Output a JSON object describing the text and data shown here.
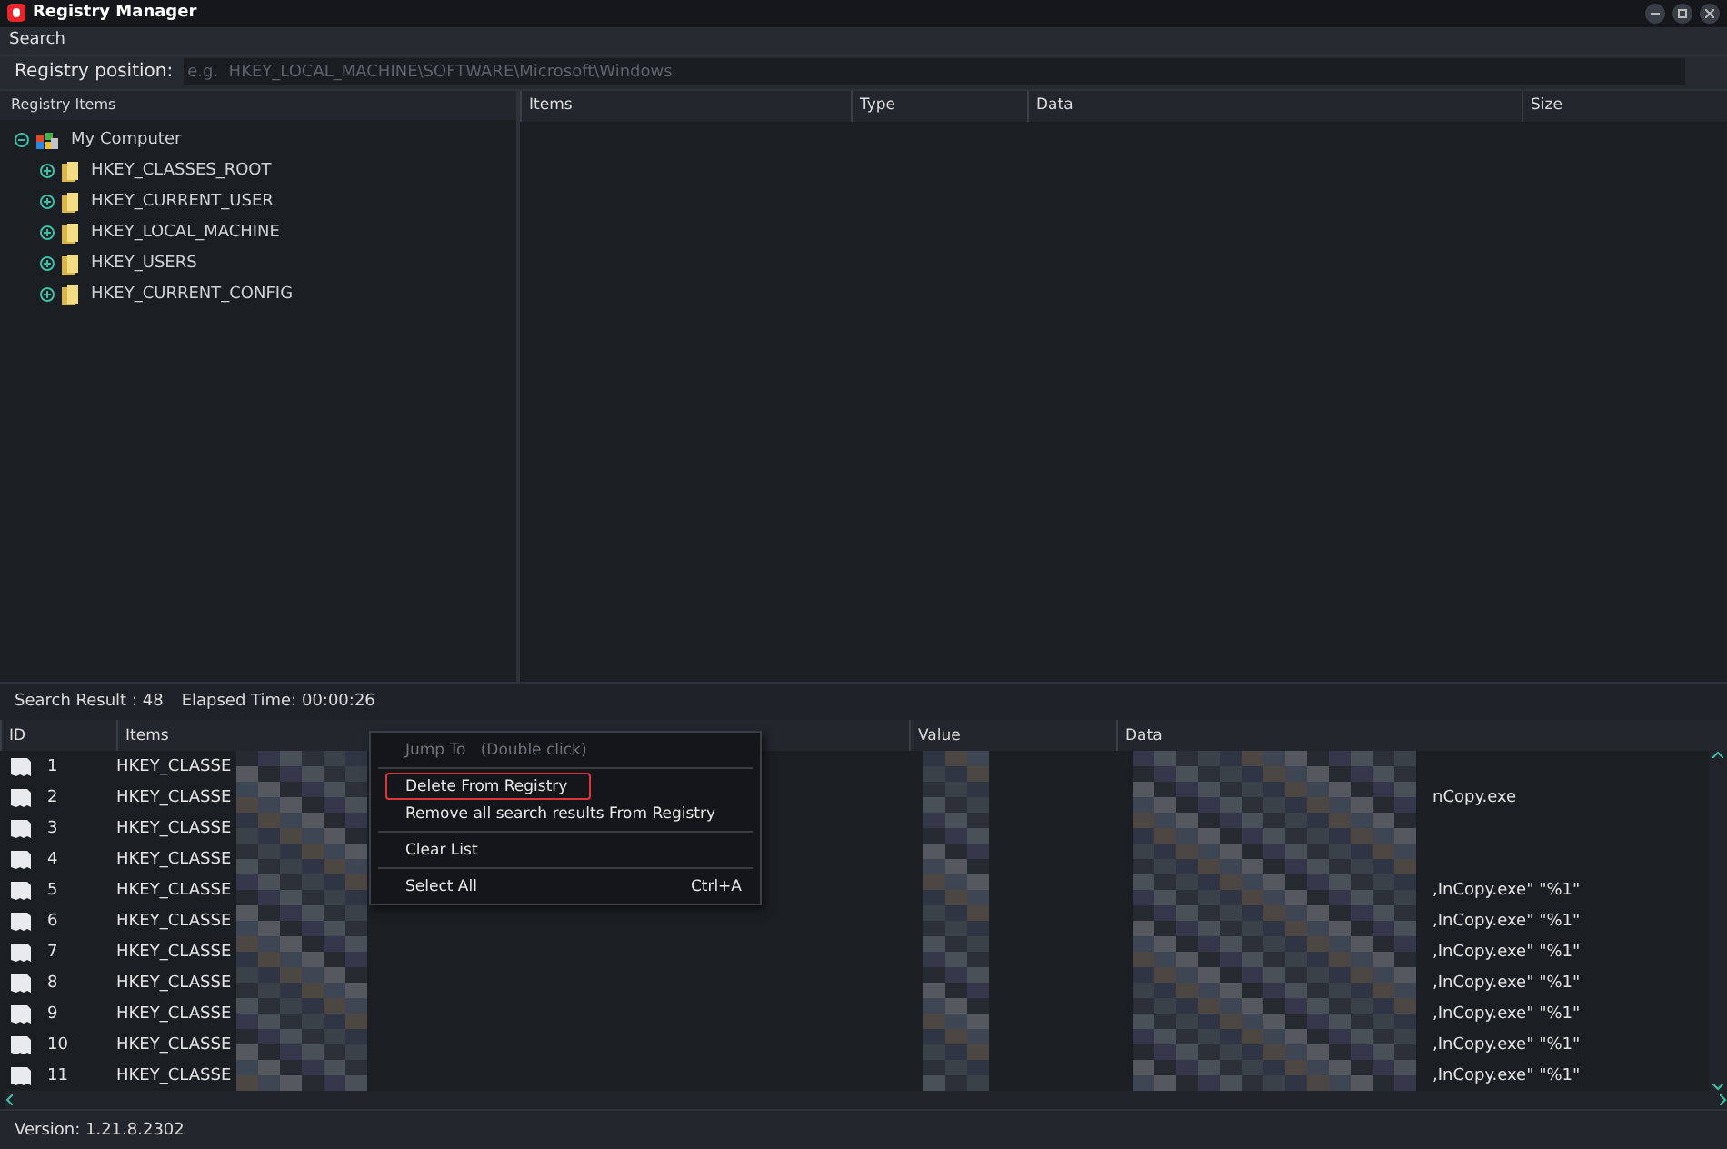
{
  "window": {
    "title": "Registry Manager"
  },
  "menu_bar": [
    {
      "label": "Search"
    }
  ],
  "position": {
    "label": "Registry position:",
    "placeholder": "e.g.  HKEY_LOCAL_MACHINE\\SOFTWARE\\Microsoft\\Windows"
  },
  "tree": {
    "title": "Registry Items",
    "items": [
      {
        "label": "My Computer",
        "expanded": true,
        "children": [
          {
            "label": "HKEY_CLASSES_ROOT",
            "expanded": false
          },
          {
            "label": "HKEY_CURRENT_USER",
            "expanded": false
          },
          {
            "label": "HKEY_LOCAL_MACHINE",
            "expanded": false
          },
          {
            "label": "HKEY_USERS",
            "expanded": false
          },
          {
            "label": "HKEY_CURRENT_CONFIG",
            "expanded": false
          }
        ]
      }
    ]
  },
  "items_table": {
    "columns": [
      "Items",
      "Type",
      "Data",
      "Size"
    ]
  },
  "results": {
    "count_label": "Search Result :",
    "count": "48",
    "elapsed_label": "Elapsed Time:",
    "elapsed": "00:00:26",
    "columns": [
      "ID",
      "Items",
      "Value",
      "Data"
    ],
    "rows": [
      {
        "id": "1",
        "item": "HKEY_CLASSE"
      },
      {
        "id": "2",
        "item": "HKEY_CLASSE",
        "data": "nCopy.exe"
      },
      {
        "id": "3",
        "item": "HKEY_CLASSE"
      },
      {
        "id": "4",
        "item": "HKEY_CLASSE"
      },
      {
        "id": "5",
        "item": "HKEY_CLASSE",
        "data": ",InCopy.exe\" \"%1\""
      },
      {
        "id": "6",
        "item": "HKEY_CLASSE",
        "data": ",InCopy.exe\" \"%1\""
      },
      {
        "id": "7",
        "item": "HKEY_CLASSE",
        "data": ",InCopy.exe\" \"%1\""
      },
      {
        "id": "8",
        "item": "HKEY_CLASSE",
        "data": ",InCopy.exe\" \"%1\""
      },
      {
        "id": "9",
        "item": "HKEY_CLASSE",
        "data": ",InCopy.exe\" \"%1\""
      },
      {
        "id": "10",
        "item": "HKEY_CLASSE",
        "data": ",InCopy.exe\" \"%1\""
      },
      {
        "id": "11",
        "item": "HKEY_CLASSE",
        "data": ",InCopy.exe\" \"%1\""
      }
    ]
  },
  "context_menu": {
    "groups": [
      [
        {
          "label": "Jump To",
          "hint": "(Double click)",
          "disabled": true,
          "selected": false
        }
      ],
      [
        {
          "label": "Delete From Registry",
          "disabled": false,
          "selected": true
        },
        {
          "label": "Remove all search results From Registry",
          "disabled": false,
          "selected": false
        }
      ],
      [
        {
          "label": "Clear List",
          "disabled": false,
          "selected": false
        }
      ],
      [
        {
          "label": "Select All",
          "shortcut": "Ctrl+A",
          "disabled": false,
          "selected": false
        }
      ]
    ]
  },
  "status_bar": {
    "version": "Version: 1.21.8.2302"
  }
}
